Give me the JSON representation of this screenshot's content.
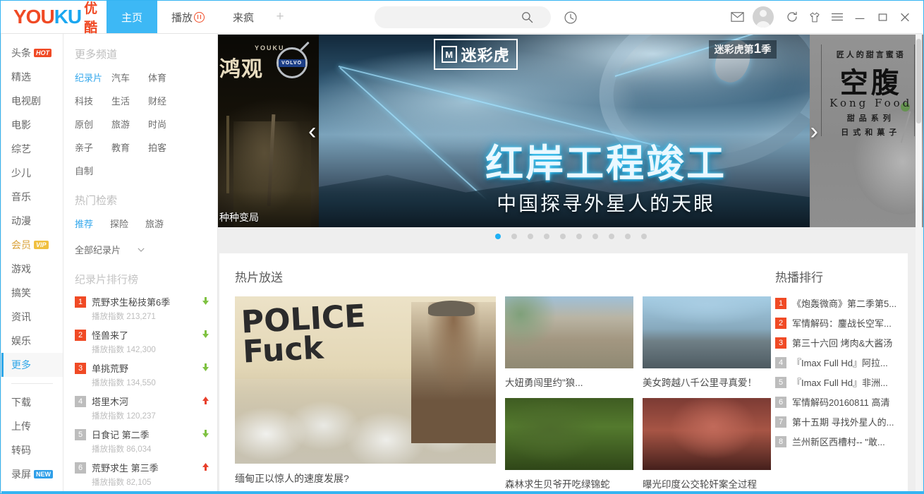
{
  "header": {
    "logo_latin_1": "YOU",
    "logo_latin_2": "KU",
    "logo_cn": "优酷",
    "tabs": [
      {
        "label": "主页",
        "active": true
      },
      {
        "label": "播放",
        "active": false,
        "has_pause_badge": true
      },
      {
        "label": "来疯",
        "active": false
      }
    ],
    "new_tab_label": "+",
    "search": {
      "value": "",
      "placeholder": ""
    },
    "icons": [
      "search-icon",
      "history-icon",
      "mail-icon",
      "avatar",
      "refresh-icon",
      "shirt-icon",
      "menu-icon",
      "minimize-icon",
      "maximize-icon",
      "close-icon"
    ]
  },
  "sidebar": {
    "items": [
      {
        "label": "头条",
        "badge": "HOT",
        "badge_type": "hot"
      },
      {
        "label": "精选"
      },
      {
        "label": "电视剧"
      },
      {
        "label": "电影"
      },
      {
        "label": "综艺"
      },
      {
        "label": "少儿"
      },
      {
        "label": "音乐"
      },
      {
        "label": "动漫"
      },
      {
        "label": "会员",
        "badge": "VIP",
        "badge_type": "vip",
        "gold": true
      },
      {
        "label": "游戏"
      },
      {
        "label": "搞笑"
      },
      {
        "label": "资讯"
      },
      {
        "label": "娱乐"
      },
      {
        "label": "更多",
        "active": true
      }
    ],
    "tools": [
      {
        "label": "下载"
      },
      {
        "label": "上传"
      },
      {
        "label": "转码"
      },
      {
        "label": "录屏",
        "badge": "NEW",
        "badge_type": "new"
      }
    ]
  },
  "panel": {
    "channels_title": "更多频道",
    "channels": [
      {
        "label": "纪录片",
        "active": true
      },
      {
        "label": "汽车"
      },
      {
        "label": "体育"
      },
      {
        "label": "科技"
      },
      {
        "label": "生活"
      },
      {
        "label": "财经"
      },
      {
        "label": "原创"
      },
      {
        "label": "旅游"
      },
      {
        "label": "时尚"
      },
      {
        "label": "亲子"
      },
      {
        "label": "教育"
      },
      {
        "label": "拍客"
      },
      {
        "label": "自制"
      }
    ],
    "hot_title": "热门检索",
    "hot_items": [
      {
        "label": "推荐",
        "active": true
      },
      {
        "label": "探险"
      },
      {
        "label": "旅游"
      }
    ],
    "filter_label": "全部纪录片",
    "rank_title": "纪录片排行榜",
    "rank_index_label": "播放指数",
    "rank_items": [
      {
        "num": "1",
        "name": "荒野求生秘技第6季",
        "index": "213,271",
        "trend": "down"
      },
      {
        "num": "2",
        "name": "怪兽来了",
        "index": "142,300",
        "trend": "down"
      },
      {
        "num": "3",
        "name": "单挑荒野",
        "index": "134,550",
        "trend": "down"
      },
      {
        "num": "4",
        "name": "塔里木河",
        "index": "120,237",
        "trend": "up"
      },
      {
        "num": "5",
        "name": "日食记 第二季",
        "index": "86,034",
        "trend": "down"
      },
      {
        "num": "6",
        "name": "荒野求生 第三季",
        "index": "82,105",
        "trend": "up"
      }
    ]
  },
  "carousel": {
    "slide_prev": {
      "brand": "YOUKU",
      "title": "鸿观",
      "sponsor": "VOLVO",
      "caption": "种种变局"
    },
    "slide_active": {
      "stamp_mark": "M",
      "stamp_text": "迷彩虎",
      "season_prefix": "迷彩虎",
      "season_label_pre": "第",
      "season_number": "1",
      "season_label_post": "季",
      "headline": "红岸工程竣工",
      "subhead": "中国探寻外星人的天眼"
    },
    "slide_next": {
      "tagline": "匠人的甜言蜜语",
      "title": "空腹",
      "title_en": "Kong Food",
      "line1": "甜品系列",
      "line2": "日式和菓子"
    },
    "prev_arrow": "‹",
    "next_arrow": "›",
    "dots_total": 10,
    "dot_active_index": 0
  },
  "main": {
    "section_title": "热片放送",
    "featured": {
      "caption": "缅甸正以惊人的速度发展?",
      "graffiti_line1": "POLICE",
      "graffiti_line2": "Fuck"
    },
    "small_cards": [
      {
        "caption": "大妞勇闯里约\"狼..."
      },
      {
        "caption": "美女跨越八千公里寻真爱！"
      },
      {
        "caption": "森林求生贝爷开吃绿锦蛇"
      },
      {
        "caption": "曝光印度公交轮奸案全过程"
      }
    ],
    "rank_title": "热播排行",
    "rank_items": [
      {
        "num": "1",
        "name": "《炮轰微商》第二季第5..."
      },
      {
        "num": "2",
        "name": "军情解码：鏖战长空军..."
      },
      {
        "num": "3",
        "name": "第三十六回 烤肉&大酱汤"
      },
      {
        "num": "4",
        "name": "『Imax Full Hd』阿拉..."
      },
      {
        "num": "5",
        "name": "『Imax Full Hd』非洲..."
      },
      {
        "num": "6",
        "name": "军情解码20160811 高清"
      },
      {
        "num": "7",
        "name": "第十五期 寻找外星人的..."
      },
      {
        "num": "8",
        "name": "兰州新区西槽村-- \"敢..."
      }
    ]
  },
  "colors": {
    "accent": "#35b4f2",
    "brand_red": "#f04a25",
    "brand_blue": "#1ba7f0",
    "vip_gold": "#d9a23a",
    "rank_top": "#f04a25",
    "rank_other": "#bdbdbd",
    "trend_up": "#e8402c",
    "trend_down": "#7fc242"
  }
}
